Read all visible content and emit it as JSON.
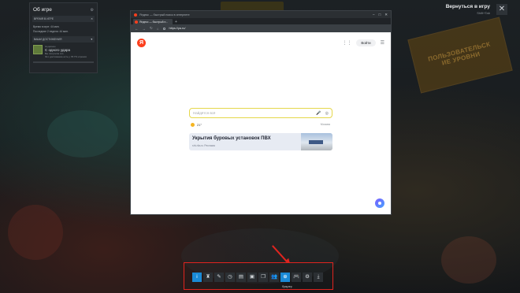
{
  "overlay": {
    "return_title": "Вернуться в игру",
    "return_shortcut": "Shift+Tab",
    "close_icon": "close-icon"
  },
  "background": {
    "sign_line1": "ПОЛЬЗОВАТЕЛЬСК",
    "sign_line2": "ИЕ УРОВНИ"
  },
  "about": {
    "title": "Об игре",
    "time_section": "ВРЕМЯ В ИГРЕ",
    "time_rows": [
      "Время в игре: 44 мин.",
      "Последние 2 недели: 44 мин."
    ],
    "ach_section": "ВАШИ ДОСТИЖЕНИЯ",
    "ach_label": "Недавние",
    "ach_name": "С одного удара",
    "ach_desc1": "Вы получили это",
    "ach_desc2": "Это достижение есть у 78.7% игроков"
  },
  "browser": {
    "window_title": "Яндекс — быстрый поиск в интернете",
    "tab_label": "Яндекс — быстрый п...",
    "url": "https://ya.ru/",
    "login": "Войти",
    "search_placeholder": "Найдётся всё",
    "weather_temp": "21°",
    "weather_city": "Москва",
    "ad_title": "Укрытия буровых установок ПВХ",
    "ad_sub": "sht-rita.ru Реклама"
  },
  "taskbar": {
    "buttons": [
      {
        "icon": "info-icon",
        "glyph": "i",
        "active": true
      },
      {
        "icon": "achievements-icon",
        "glyph": "♜",
        "active": false
      },
      {
        "icon": "guides-icon",
        "glyph": "✎",
        "active": false
      },
      {
        "icon": "recordings-icon",
        "glyph": "◷",
        "active": false
      },
      {
        "icon": "notes-icon",
        "glyph": "▤",
        "active": false
      },
      {
        "icon": "chat-icon",
        "glyph": "▣",
        "active": false
      },
      {
        "icon": "discussions-icon",
        "glyph": "❐",
        "active": false
      },
      {
        "icon": "friends-icon",
        "glyph": "👥",
        "active": false
      },
      {
        "icon": "browser-icon",
        "glyph": "⊕",
        "active": true
      },
      {
        "icon": "controller-icon",
        "glyph": "🎮",
        "active": false
      },
      {
        "icon": "settings-icon",
        "glyph": "⚙",
        "active": false
      },
      {
        "icon": "downloads-icon",
        "glyph": "⤓",
        "active": false
      }
    ],
    "active_label": "браузер"
  },
  "colors": {
    "highlight_red": "#e0241f",
    "active_blue": "#1a8ad6",
    "yandex_red": "#fc3f1d"
  }
}
